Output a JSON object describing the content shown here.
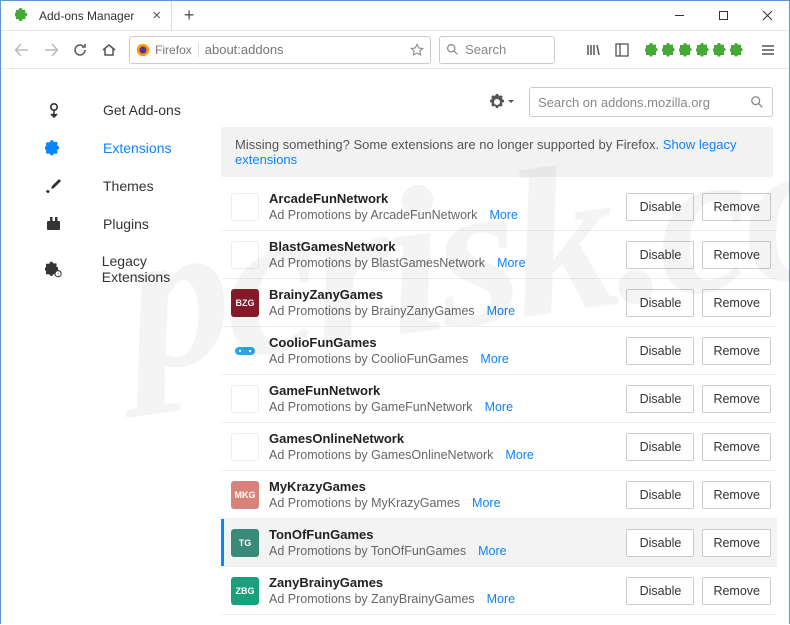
{
  "window": {
    "tab_title": "Add-ons Manager"
  },
  "navbar": {
    "brand_label": "Firefox",
    "url": "about:addons",
    "search_placeholder": "Search"
  },
  "sidebar": {
    "items": [
      {
        "label": "Get Add-ons",
        "icon": "download"
      },
      {
        "label": "Extensions",
        "icon": "puzzle",
        "active": true
      },
      {
        "label": "Themes",
        "icon": "brush"
      },
      {
        "label": "Plugins",
        "icon": "plugin"
      },
      {
        "label": "Legacy Extensions",
        "icon": "legacy"
      }
    ]
  },
  "header": {
    "amo_search_placeholder": "Search on addons.mozilla.org"
  },
  "notice": {
    "text": "Missing something? Some extensions are no longer supported by Firefox. ",
    "link": "Show legacy extensions"
  },
  "buttons": {
    "disable": "Disable",
    "remove": "Remove",
    "more": "More"
  },
  "extensions": [
    {
      "name": "ArcadeFunNetwork",
      "desc": "Ad Promotions by ArcadeFunNetwork",
      "thumb_bg": "#ffffff",
      "thumb_fg": "#999",
      "thumb_tx": ""
    },
    {
      "name": "BlastGamesNetwork",
      "desc": "Ad Promotions by BlastGamesNetwork",
      "thumb_bg": "#ffffff",
      "thumb_fg": "#999",
      "thumb_tx": ""
    },
    {
      "name": "BrainyZanyGames",
      "desc": "Ad Promotions by BrainyZanyGames",
      "thumb_bg": "#8a1b2a",
      "thumb_fg": "#fff",
      "thumb_tx": "BZG"
    },
    {
      "name": "CoolioFunGames",
      "desc": "Ad Promotions by CoolioFunGames",
      "thumb_bg": "#ffffff",
      "thumb_fg": "#2aa6e0",
      "thumb_tx": "",
      "icon": "gamepad"
    },
    {
      "name": "GameFunNetwork",
      "desc": "Ad Promotions by GameFunNetwork",
      "thumb_bg": "#ffffff",
      "thumb_fg": "#999",
      "thumb_tx": ""
    },
    {
      "name": "GamesOnlineNetwork",
      "desc": "Ad Promotions by GamesOnlineNetwork",
      "thumb_bg": "#ffffff",
      "thumb_fg": "#999",
      "thumb_tx": ""
    },
    {
      "name": "MyKrazyGames",
      "desc": "Ad Promotions by MyKrazyGames",
      "thumb_bg": "#d7827a",
      "thumb_fg": "#fff",
      "thumb_tx": "MKG"
    },
    {
      "name": "TonOfFunGames",
      "desc": "Ad Promotions by TonOfFunGames",
      "thumb_bg": "#3a8a7a",
      "thumb_fg": "#fff",
      "thumb_tx": "TG",
      "selected": true
    },
    {
      "name": "ZanyBrainyGames",
      "desc": "Ad Promotions by ZanyBrainyGames",
      "thumb_bg": "#1aa07c",
      "thumb_fg": "#fff",
      "thumb_tx": "ZBG"
    }
  ],
  "watermark": "pcrisk.com"
}
